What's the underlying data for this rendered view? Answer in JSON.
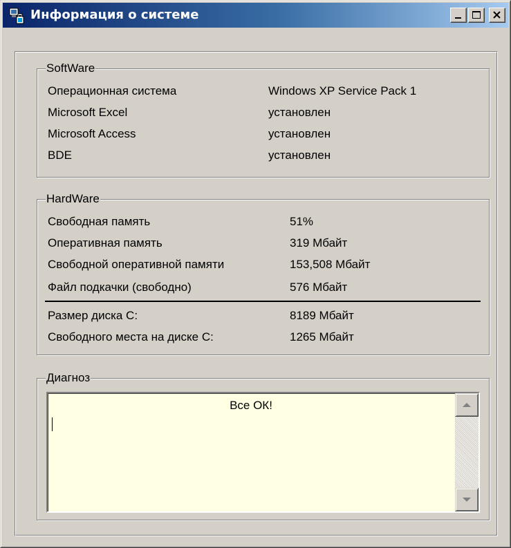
{
  "window": {
    "title": "Информация о системе",
    "icon": "system-info-icon",
    "controls": {
      "minimize": "minimize-icon",
      "maximize": "maximize-icon",
      "close": "close-icon"
    }
  },
  "software": {
    "legend": "SoftWare",
    "rows": [
      {
        "label": "Операционная система",
        "value": "Windows XP Service Pack 1"
      },
      {
        "label": "Microsoft Excel",
        "value": "установлен"
      },
      {
        "label": "Microsoft Access",
        "value": "установлен"
      },
      {
        "label": "BDE",
        "value": "установлен"
      }
    ]
  },
  "hardware": {
    "legend": "HardWare",
    "rows": [
      {
        "label": "Свободная память",
        "value": "51%"
      },
      {
        "label": "Оперативная память",
        "value": "319 Мбайт"
      },
      {
        "label": "Свободной оперативной памяти",
        "value": "153,508 Мбайт"
      },
      {
        "label": "Файл подкачки (свободно)",
        "value": "576 Мбайт"
      },
      {
        "label": "Размер диска С:",
        "value": "8189 Мбайт"
      },
      {
        "label": "Свободного места на диске С:",
        "value": "1265 Мбайт"
      }
    ]
  },
  "diagnosis": {
    "legend": "Диагноз",
    "text": "Все ОК!"
  },
  "colors": {
    "face": "#d4d0c8",
    "title_start": "#0a246a",
    "title_end": "#a6caf0",
    "memo_bg": "#ffffe4"
  }
}
